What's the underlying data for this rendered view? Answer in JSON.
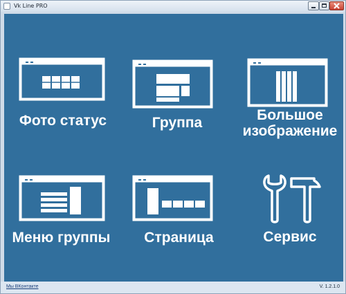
{
  "window": {
    "title": "Vk Line PRO"
  },
  "tiles": [
    {
      "label": "Фото статус",
      "icon": "photo-status-icon"
    },
    {
      "label": "Группа",
      "icon": "group-icon"
    },
    {
      "label_line1": "Большое",
      "label_line2": "изображение",
      "icon": "large-image-icon"
    },
    {
      "label": "Меню группы",
      "icon": "group-menu-icon"
    },
    {
      "label": "Страница",
      "icon": "page-icon"
    },
    {
      "label": "Сервис",
      "icon": "service-tools-icon"
    }
  ],
  "footer": {
    "link": "Мы ВКонтакте",
    "version": "V. 1.2.1.0"
  },
  "colors": {
    "background": "#316f9d",
    "icon": "#ffffff"
  }
}
